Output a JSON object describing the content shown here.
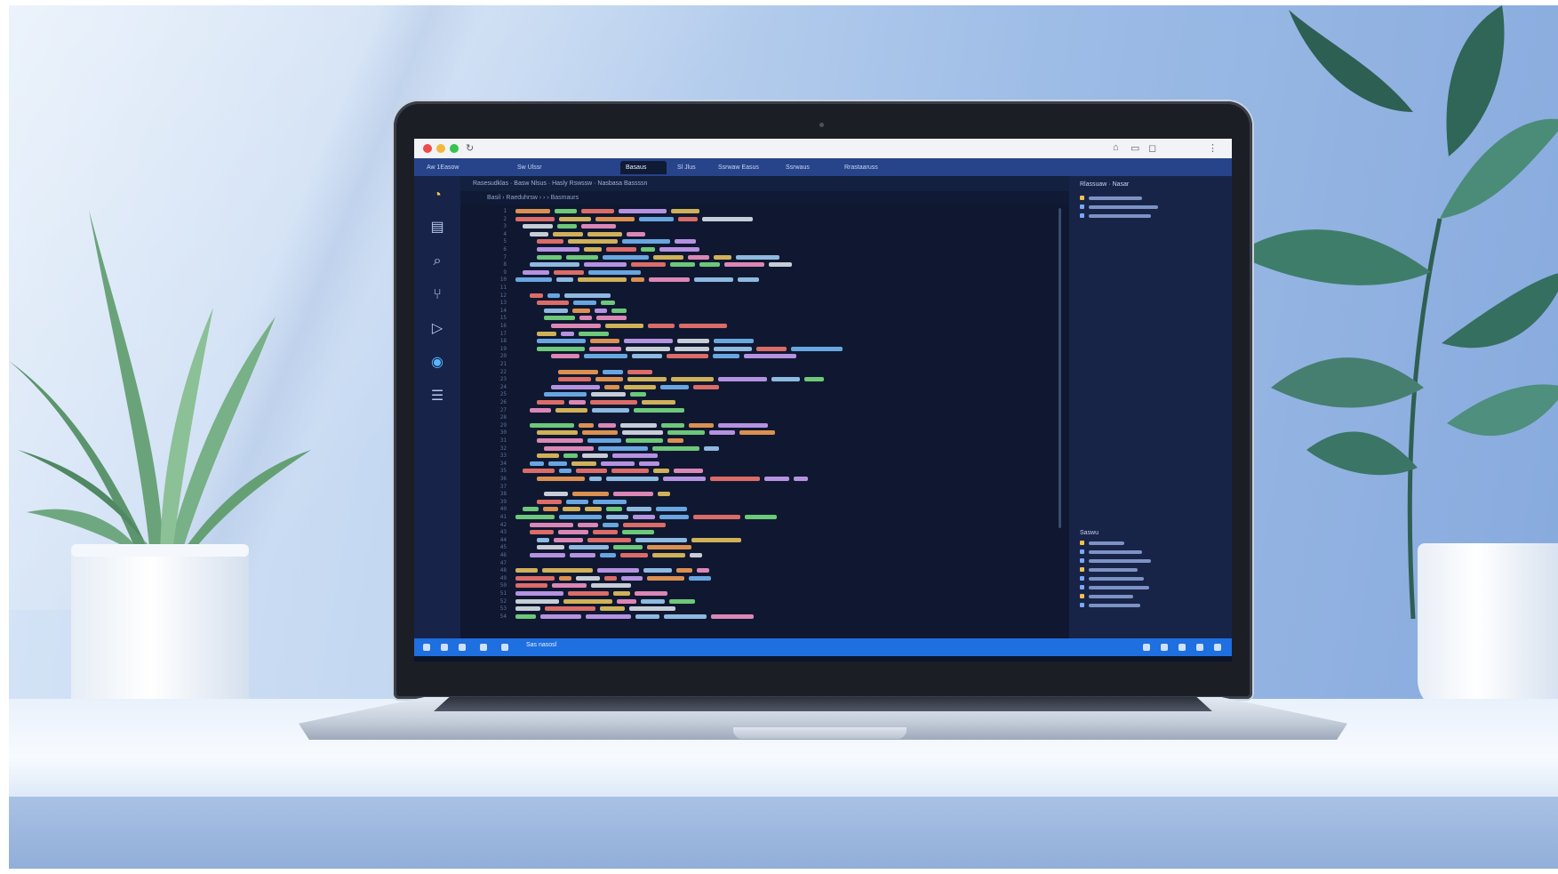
{
  "scene": {
    "description_colors": {
      "wall": "#a9c4ea",
      "desk": "#eef4fb",
      "screen_bg": "#0f1830",
      "status_bar": "#1e6fe0",
      "tab_strip": "#27438a",
      "plant_leaf": "#3f7d6b"
    }
  },
  "browser": {
    "traffic_lights": [
      "close",
      "minimize",
      "maximize"
    ],
    "icons": [
      "refresh-icon",
      "share-icon",
      "copy-icon",
      "tabs-icon",
      "menu-icon"
    ]
  },
  "tabs": [
    {
      "label": "Aw 1Easow"
    },
    {
      "label": "Sw Ulssr"
    },
    {
      "label": "Basaus",
      "active": true
    },
    {
      "label": "Sl Jlus"
    },
    {
      "label": "Ssrwaw Easus"
    },
    {
      "label": "Ssrwaus"
    },
    {
      "label": "Rrastaaruss"
    }
  ],
  "editor": {
    "top_bar": "Rasesudklas · Basw Nlsus · Hasly    Rswssw    ·    Nasbasa Bassssn",
    "breadcrumb": "Basil  ›  Raeduhrsw  ›  ›  ›  Basmaurs",
    "line_numbers": [
      "1",
      "2",
      "3",
      "4",
      "5",
      "6",
      "7",
      "8",
      "9",
      "10",
      "11",
      "12",
      "13",
      "14",
      "15",
      "16",
      "17",
      "18",
      "19",
      "20",
      "21",
      "22",
      "23",
      "24",
      "25",
      "26",
      "27",
      "28",
      "29",
      "30",
      "31",
      "32",
      "33",
      "34",
      "35",
      "36",
      "37",
      "38",
      "39",
      "40",
      "41",
      "42",
      "43",
      "44",
      "45",
      "46",
      "47",
      "48",
      "49",
      "50",
      "51",
      "52",
      "53",
      "54"
    ]
  },
  "right_panel": {
    "title": "Rlassuaw · Nasar",
    "lower_title": "Saswu"
  },
  "status_bar": {
    "text": "Sas nasosl"
  }
}
